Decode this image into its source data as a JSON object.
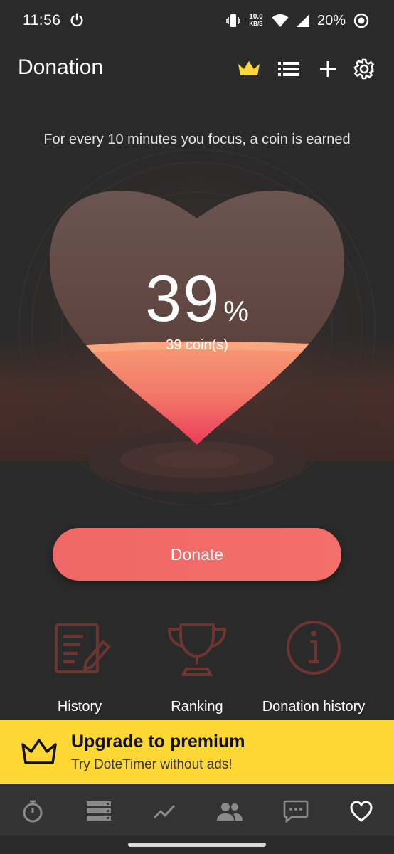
{
  "status_bar": {
    "time": "11:56",
    "net_speed_value": "10.0",
    "net_speed_unit": "KB/S",
    "battery": "20%",
    "icons": [
      "power-icon",
      "vibrate-icon",
      "wifi-icon",
      "signal-icon",
      "battery-icon"
    ]
  },
  "app_bar": {
    "title": "Donation",
    "actions": [
      "crown-icon",
      "list-icon",
      "plus-icon",
      "gear-icon"
    ],
    "crown_color": "#fdd835"
  },
  "subtitle": "For every 10 minutes you focus, a coin is earned",
  "progress": {
    "percent_value": "39",
    "percent_sign": "%",
    "coins_label": "39 coin(s)",
    "fill_fraction": 0.39
  },
  "donate_button": {
    "label": "Donate",
    "color": "#ef6766"
  },
  "quick_actions": [
    {
      "label": "History",
      "icon": "document-edit-icon"
    },
    {
      "label": "Ranking",
      "icon": "trophy-icon"
    },
    {
      "label": "Donation history",
      "icon": "info-icon"
    }
  ],
  "premium_banner": {
    "title": "Upgrade to premium",
    "subtitle": "Try DoteTimer without ads!",
    "color": "#fdd835"
  },
  "bottom_nav": {
    "items": [
      "timer-icon",
      "list-icon",
      "chart-icon",
      "group-icon",
      "chat-icon",
      "heart-icon"
    ],
    "active": "heart-icon"
  }
}
